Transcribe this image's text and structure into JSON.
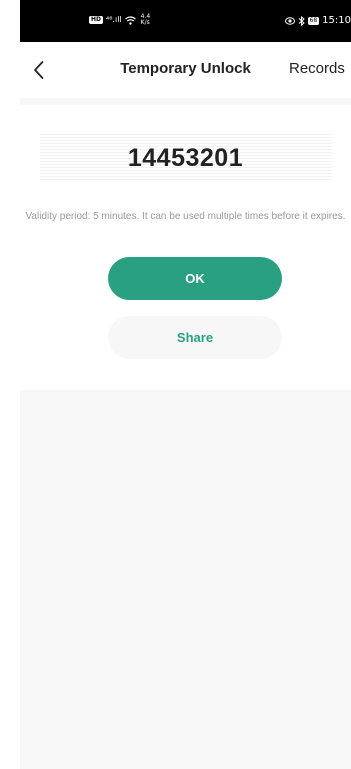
{
  "status_bar": {
    "hd_badge": "HD",
    "signal_text": "⁴⁶.ıll",
    "wifi_icon": "wifi-icon",
    "speed_value": "4.4",
    "speed_unit": "K/s",
    "eye_icon": "eye-icon",
    "bluetooth_icon": "bluetooth-icon",
    "battery_level": "68",
    "time": "15:10"
  },
  "nav": {
    "back_icon": "chevron-left-icon",
    "title": "Temporary Unlock",
    "records_label": "Records"
  },
  "code": {
    "value": "14453201"
  },
  "validity_text": "Validity period: 5 minutes. It can be used multiple times before it expires.",
  "buttons": {
    "ok_label": "OK",
    "share_label": "Share"
  },
  "colors": {
    "accent": "#2aa083",
    "share_bg": "#f7f7f7",
    "text_dark": "#222222",
    "text_muted": "#9a9a9a"
  }
}
